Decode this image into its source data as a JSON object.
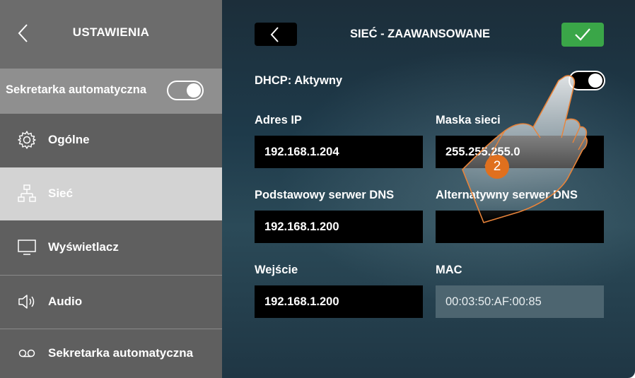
{
  "sidebar": {
    "title": "USTAWIENIA",
    "answering_machine_toggle": {
      "label": "Sekretarka automatyczna",
      "state": "on"
    },
    "items": [
      {
        "label": "Ogólne",
        "icon": "gear-icon",
        "active": false
      },
      {
        "label": "Sieć",
        "icon": "network-icon",
        "active": true
      },
      {
        "label": "Wyświetlacz",
        "icon": "monitor-icon",
        "active": false
      },
      {
        "label": "Audio",
        "icon": "speaker-icon",
        "active": false
      },
      {
        "label": "Sekretarka automatyczna",
        "icon": "voicemail-icon",
        "active": false
      }
    ]
  },
  "main": {
    "title": "SIEĆ - ZAAWANSOWANE",
    "dhcp": {
      "label": "DHCP: Aktywny",
      "state": "on"
    },
    "fields": {
      "ip": {
        "label": "Adres IP",
        "value": "192.168.1.204"
      },
      "mask": {
        "label": "Maska sieci",
        "value": "255.255.255.0"
      },
      "dns1": {
        "label": "Podstawowy serwer DNS",
        "value": "192.168.1.200"
      },
      "dns2": {
        "label": "Alternatywny serwer DNS",
        "value": ""
      },
      "gateway": {
        "label": "Wejście",
        "value": "192.168.1.200"
      },
      "mac": {
        "label": "MAC",
        "value": "00:03:50:AF:00:85"
      }
    },
    "step_marker": "2"
  },
  "colors": {
    "sidebar_bg": "#5f5f5f",
    "sidebar_active": "#d3d3d3",
    "main_bg": "#1e3a4a",
    "confirm": "#3aa648",
    "step": "#e0701e"
  }
}
